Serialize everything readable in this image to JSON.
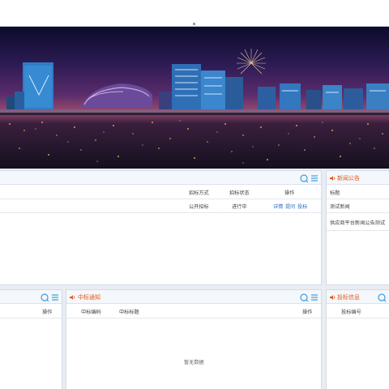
{
  "colors": {
    "accent_title": "#e05a1a",
    "link": "#2d6fc2",
    "icon": "#3a9de0",
    "panel_header": "#f4f7fb"
  },
  "banner": {
    "image": "city-night-skyline-banner"
  },
  "projects_panel": {
    "columns": {
      "method": "招标方式",
      "status": "招标状态",
      "action": "操作"
    },
    "rows": [
      {
        "method": "公开招标",
        "status": "进行中",
        "actions": [
          "详情",
          "提问",
          "投标"
        ]
      }
    ]
  },
  "news_panel": {
    "title": "新闻公告",
    "column": "标题",
    "items": [
      "测试新闻",
      "供应商平台新闻公告测试"
    ]
  },
  "left_panel": {
    "column_action": "操作"
  },
  "award_panel": {
    "title": "中标通知",
    "columns": {
      "code": "中标编码",
      "title": "中标标题",
      "action": "操作"
    },
    "empty_text": "暂无数据"
  },
  "bid_info_panel": {
    "title": "投标信息",
    "columns": {
      "code": "投标编号"
    }
  }
}
